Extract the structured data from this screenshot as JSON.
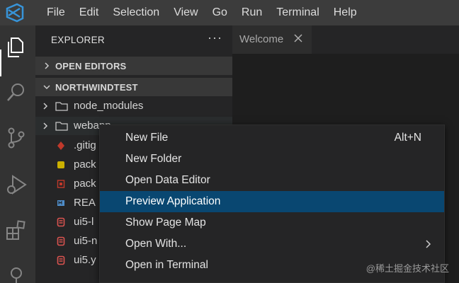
{
  "menu": [
    "File",
    "Edit",
    "Selection",
    "View",
    "Go",
    "Run",
    "Terminal",
    "Help"
  ],
  "sidebar": {
    "title": "EXPLORER",
    "more": "···",
    "sections": [
      {
        "label": "OPEN EDITORS"
      },
      {
        "label": "NORTHWINDTEST"
      }
    ],
    "folders": [
      {
        "name": "node_modules"
      },
      {
        "name": "webapp"
      }
    ],
    "files": [
      {
        "name": ".gitig",
        "icon": "git-icon",
        "color": "#c0392b"
      },
      {
        "name": "pack",
        "icon": "json-icon",
        "color": "#cbb000"
      },
      {
        "name": "pack",
        "icon": "npm-icon",
        "color": "#c0392b"
      },
      {
        "name": "REA",
        "icon": "markdown-icon",
        "color": "#4f8dc9"
      },
      {
        "name": "ui5-l",
        "icon": "yaml-icon",
        "color": "#d9534f"
      },
      {
        "name": "ui5-n",
        "icon": "yaml-icon",
        "color": "#d9534f"
      },
      {
        "name": "ui5.y",
        "icon": "yaml-icon",
        "color": "#d9534f"
      }
    ]
  },
  "editor": {
    "tab_label": "Welcome"
  },
  "context_menu": {
    "items": [
      {
        "label": "New File",
        "shortcut": "Alt+N"
      },
      {
        "label": "New Folder"
      },
      {
        "label": "Open Data Editor"
      },
      {
        "label": "Preview Application",
        "selected": true
      },
      {
        "label": "Show Page Map"
      },
      {
        "label": "Open With...",
        "submenu": true
      },
      {
        "label": "Open in Terminal"
      }
    ]
  },
  "watermark": "@稀土掘金技术社区",
  "colors": {
    "accent": "#094771",
    "titlebar": "#3c3c3c",
    "activitybar": "#333333",
    "sidebar": "#252526",
    "editor": "#1e1e1e"
  }
}
